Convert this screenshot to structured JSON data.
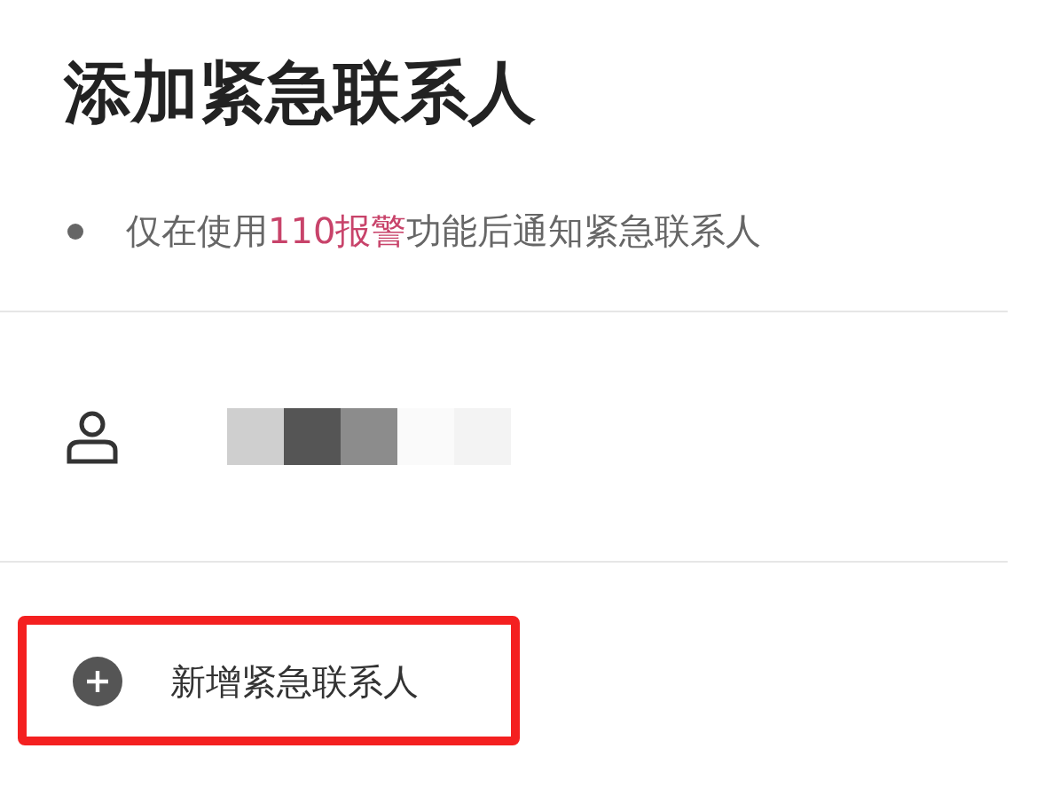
{
  "title": "添加紧急联系人",
  "note": {
    "before": "仅在使用",
    "highlight": "110报警",
    "after": "功能后通知紧急联系人"
  },
  "contacts": [
    {
      "name_redacted": true
    }
  ],
  "add_button": {
    "label": "新增紧急联系人",
    "highlighted": true
  }
}
